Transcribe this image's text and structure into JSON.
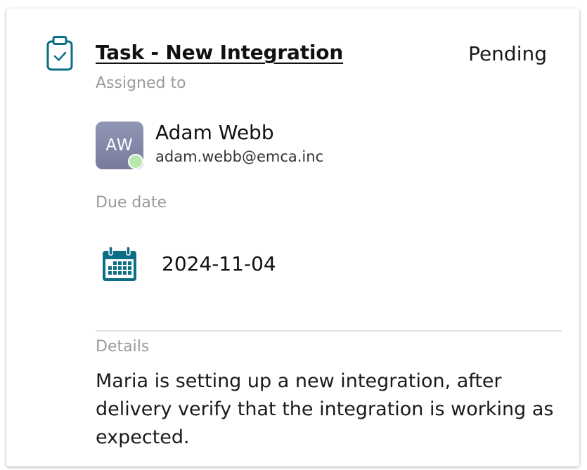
{
  "task": {
    "title": "Task - New Integration",
    "status": "Pending"
  },
  "assigned": {
    "label": "Assigned to",
    "avatar_initials": "AW",
    "name": "Adam Webb",
    "email": "adam.webb@emca.inc",
    "presence": "online"
  },
  "due": {
    "label": "Due date",
    "value": "2024-11-04"
  },
  "details": {
    "label": "Details",
    "text": "Maria is setting up a new integration, after delivery verify that the integration is working as expected."
  },
  "icons": {
    "task": "clipboard-check-icon",
    "due": "calendar-icon"
  },
  "colors": {
    "accent": "#0b6e86",
    "avatar": "#858aa8",
    "presence": "#b6e8b0",
    "muted_text": "#9a9a9a"
  }
}
